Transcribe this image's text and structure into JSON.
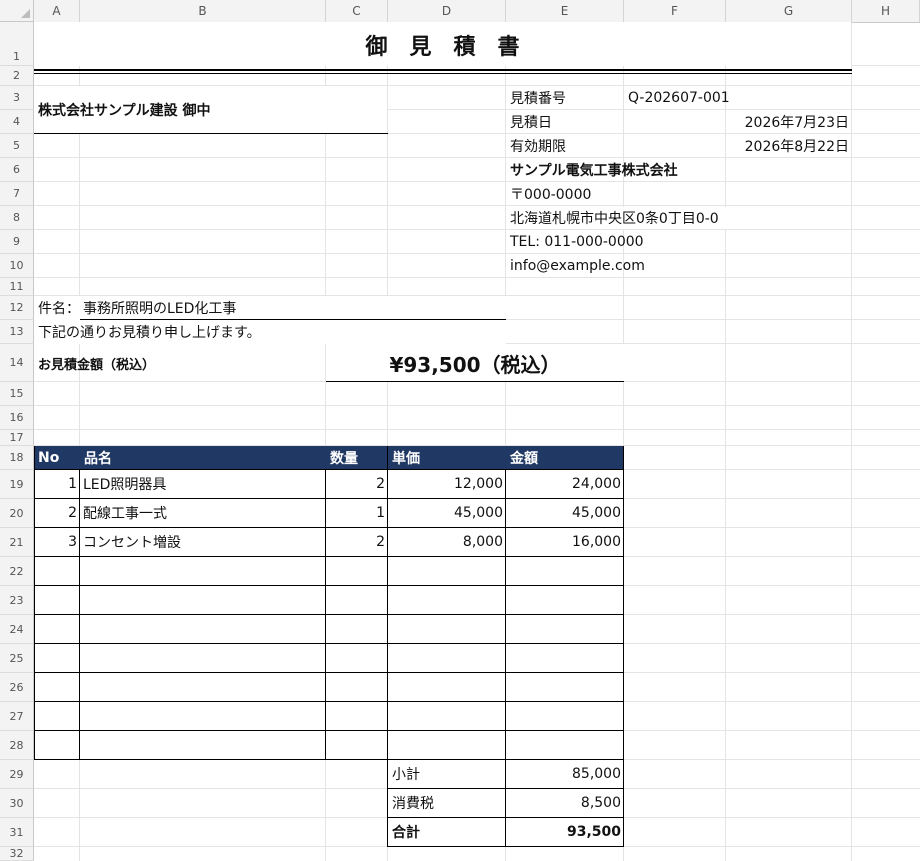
{
  "columns": [
    "A",
    "B",
    "C",
    "D",
    "E",
    "F",
    "G",
    "H"
  ],
  "rows": [
    "1",
    "2",
    "3",
    "4",
    "5",
    "6",
    "7",
    "8",
    "9",
    "10",
    "11",
    "12",
    "13",
    "14",
    "15",
    "16",
    "17",
    "18",
    "19",
    "20",
    "21",
    "22",
    "23",
    "24",
    "25",
    "26",
    "27",
    "28",
    "29",
    "30",
    "31",
    "32"
  ],
  "title": "御　見　積　書",
  "client": "株式会社サンプル建設 御中",
  "meta": {
    "estimate_no_label": "見積番号",
    "estimate_no": "Q-202607-001",
    "date_label": "見積日",
    "date": "2026年7月23日",
    "expiry_label": "有効期限",
    "expiry": "2026年8月22日"
  },
  "company": {
    "name": "サンプル電気工事株式会社",
    "postal": "〒000-0000",
    "address": "北海道札幌市中央区0条0丁目0-0",
    "tel": "TEL: 011-000-0000",
    "email": "info@example.com"
  },
  "subject_label": "件名：",
  "subject": "事務所照明のLED化工事",
  "intro": "下記の通りお見積り申し上げます。",
  "amount_label": "お見積金額（税込）",
  "amount": "¥93,500（税込）",
  "table": {
    "headers": [
      "No",
      "品名",
      "数量",
      "単価",
      "金額"
    ],
    "rows": [
      [
        "1",
        "LED照明器具",
        "2",
        "12,000",
        "24,000"
      ],
      [
        "2",
        "配線工事一式",
        "1",
        "45,000",
        "45,000"
      ],
      [
        "3",
        "コンセント増設",
        "2",
        "8,000",
        "16,000"
      ]
    ]
  },
  "totals": {
    "subtotal_label": "小計",
    "subtotal": "85,000",
    "tax_label": "消費税",
    "tax": "8,500",
    "total_label": "合計",
    "total": "93,500"
  },
  "colors": {
    "header_fill": "#1f3864",
    "header_text": "#ffffff"
  }
}
